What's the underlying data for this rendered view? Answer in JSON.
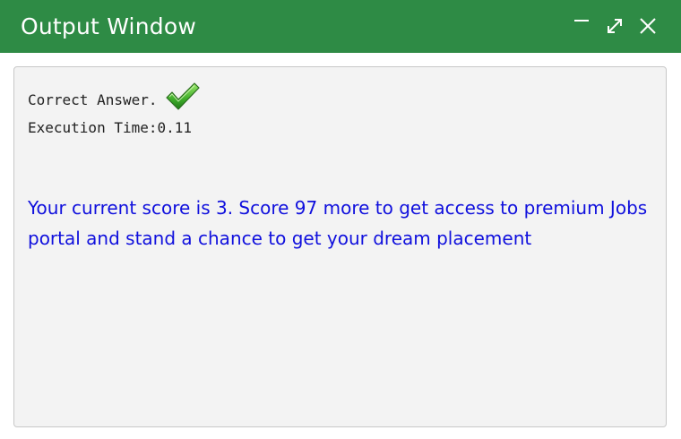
{
  "window": {
    "title": "Output Window",
    "accent_color": "#2e8b45",
    "controls": [
      {
        "name": "minimize",
        "icon": "minimize-icon"
      },
      {
        "name": "maximize",
        "icon": "expand-icon"
      },
      {
        "name": "close",
        "icon": "close-icon"
      }
    ]
  },
  "output": {
    "result_label": "Correct Answer.",
    "result_icon": "check-icon",
    "execution_time": "Execution Time:0.11",
    "score_message": "Your current score is 3. Score 97 more to get access to premium Jobs portal and stand a chance to get your dream placement",
    "message_color": "#1010dd"
  }
}
